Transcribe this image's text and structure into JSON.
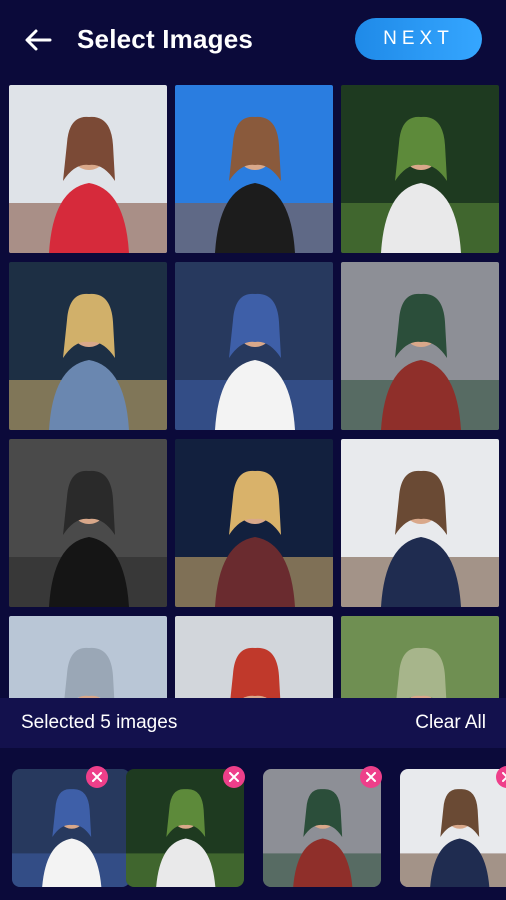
{
  "header": {
    "title": "Select Images",
    "next_label": "NEXT",
    "back_icon": "arrow-left-icon"
  },
  "grid": {
    "images": [
      {
        "name": "photo-red-scarf",
        "colors": {
          "bg": "#dfe3e8",
          "main": "#d62a3b",
          "accent": "#7b4a36"
        }
      },
      {
        "name": "photo-blue-sky",
        "colors": {
          "bg": "#2a7de0",
          "main": "#1c1c1c",
          "accent": "#8a5a3c"
        }
      },
      {
        "name": "photo-swing",
        "colors": {
          "bg": "#1e3a20",
          "main": "#e9e9ea",
          "accent": "#5d8a3a"
        }
      },
      {
        "name": "photo-denim-jacket",
        "colors": {
          "bg": "#1d2f44",
          "main": "#6a87b0",
          "accent": "#d1b06a"
        }
      },
      {
        "name": "photo-stairs",
        "colors": {
          "bg": "#27395e",
          "main": "#f3f3f3",
          "accent": "#3e5fa8"
        }
      },
      {
        "name": "photo-road",
        "colors": {
          "bg": "#8d8f96",
          "main": "#8f2f2a",
          "accent": "#2b4e3a"
        }
      },
      {
        "name": "photo-black-hoodie",
        "colors": {
          "bg": "#4a4a4a",
          "main": "#151515",
          "accent": "#2a2a2a"
        }
      },
      {
        "name": "photo-lights",
        "colors": {
          "bg": "#12203e",
          "main": "#6a2b2f",
          "accent": "#d9b26a"
        }
      },
      {
        "name": "photo-sunglasses-smile",
        "colors": {
          "bg": "#e8eaed",
          "main": "#1f2c50",
          "accent": "#6a4a34"
        }
      },
      {
        "name": "photo-building",
        "colors": {
          "bg": "#b9c6d6",
          "main": "#5a4636",
          "accent": "#9aa7b6"
        }
      },
      {
        "name": "photo-bus",
        "colors": {
          "bg": "#d2d6db",
          "main": "#2a2a2a",
          "accent": "#c0392b"
        }
      },
      {
        "name": "photo-trees-path",
        "colors": {
          "bg": "#6f8f52",
          "main": "#2a2a2a",
          "accent": "#a7b58b"
        }
      }
    ]
  },
  "selection": {
    "text": "Selected 5 images",
    "clear_label": "Clear All",
    "remove_icon": "close-icon",
    "thumbnails": [
      {
        "name": "thumb-stairs",
        "colors": {
          "bg": "#27395e",
          "main": "#f3f3f3",
          "accent": "#3e5fa8"
        }
      },
      {
        "name": "thumb-swing",
        "colors": {
          "bg": "#1e3a20",
          "main": "#e9e9ea",
          "accent": "#5d8a3a"
        }
      },
      {
        "name": "thumb-road",
        "colors": {
          "bg": "#8d8f96",
          "main": "#8f2f2a",
          "accent": "#2b4e3a"
        }
      },
      {
        "name": "thumb-sunglasses-smile",
        "colors": {
          "bg": "#e8eaed",
          "main": "#1f2c50",
          "accent": "#6a4a34"
        }
      },
      {
        "name": "thumb-extra",
        "colors": {
          "bg": "#3b2d4a",
          "main": "#d9d9d9",
          "accent": "#7a5a44"
        }
      }
    ]
  },
  "colors": {
    "background": "#0b0a3a",
    "selection_bar": "#13114d",
    "accent_blue": "#2a97f2",
    "remove_pink": "#ee3f8a"
  }
}
